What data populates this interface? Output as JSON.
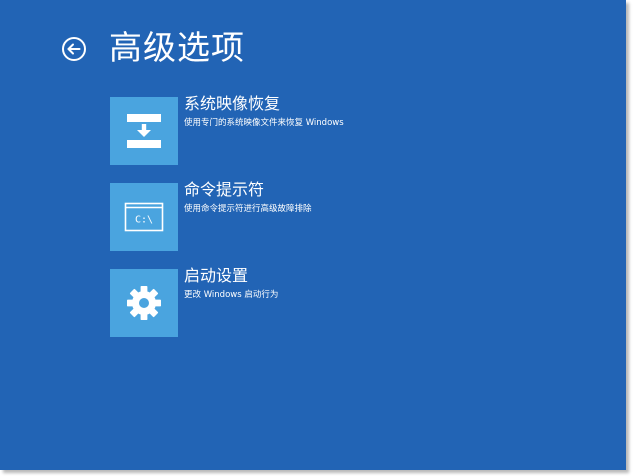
{
  "header": {
    "title": "高级选项",
    "back_icon": "back-arrow-circle-icon"
  },
  "colors": {
    "background": "#2264b5",
    "tile": "#4aa4df",
    "text": "#ffffff"
  },
  "options": [
    {
      "title": "系统映像恢复",
      "description": "使用专门的系统映像文件来恢复 Windows",
      "icon": "system-image-recovery-icon"
    },
    {
      "title": "命令提示符",
      "description": "使用命令提示符进行高级故障排除",
      "icon": "command-prompt-icon",
      "icon_text": "C:\\"
    },
    {
      "title": "启动设置",
      "description": "更改 Windows 启动行为",
      "icon": "gear-icon"
    }
  ]
}
